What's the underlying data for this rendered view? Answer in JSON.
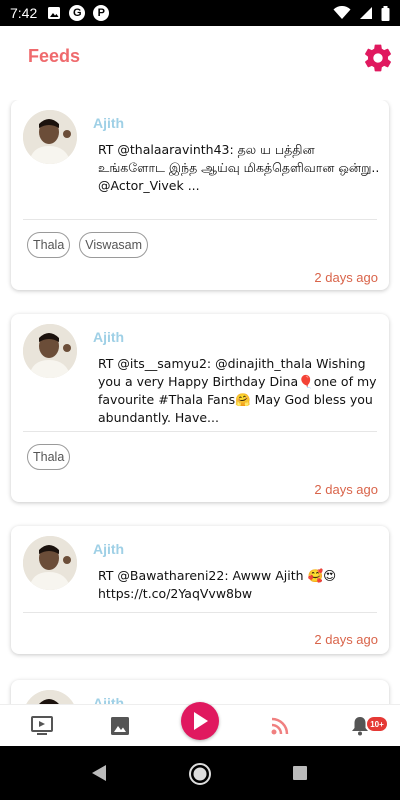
{
  "status_bar": {
    "time": "7:42",
    "icons": [
      "image-icon",
      "google-icon",
      "p-icon"
    ],
    "right_icons": [
      "wifi-icon",
      "signal-icon",
      "battery-icon"
    ],
    "google_glyph": "G",
    "p_glyph": "P"
  },
  "app": {
    "title": "Feeds",
    "accent_color": "#ef6a6d",
    "settings_icon": "gear-icon",
    "settings_color": "#e0195f"
  },
  "feeds": [
    {
      "author": "Ajith",
      "text": "RT @thalaaravinth43: தல ய பத்தின உங்களோட இந்த ஆய்வு மிகத்தெளிவான ஒன்று.. @Actor_Vivek ...",
      "tags": [
        "Thala",
        "Viswasam"
      ],
      "time": "2 days ago"
    },
    {
      "author": "Ajith",
      "text": "RT @its__samyu2: @dinajith_thala Wishing you a very Happy Birthday Dina🎈one of my favourite #Thala Fans🤗 May God bless you abundantly. Have...",
      "tags": [
        "Thala"
      ],
      "time": "2 days ago"
    },
    {
      "author": "Ajith",
      "text": "RT @Bawathareni22: Awww Ajith 🥰😍 https://t.co/2YaqVvw8bw",
      "tags": [],
      "time": "2 days ago"
    },
    {
      "author": "Ajith",
      "text": "",
      "tags": [],
      "time": ""
    }
  ],
  "bottom_nav": {
    "items": [
      "tv-icon",
      "image-icon",
      "play-icon",
      "rss-icon",
      "bell-icon"
    ],
    "notification_badge": "10+",
    "play_color": "#e0195f",
    "rss_color": "#f08080"
  },
  "system_nav": [
    "back-icon",
    "home-icon",
    "recents-icon"
  ]
}
